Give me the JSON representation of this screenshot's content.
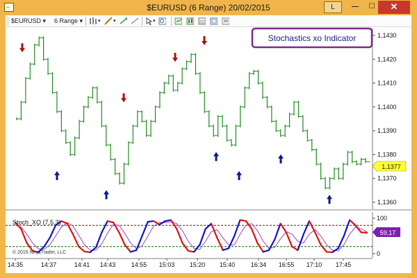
{
  "window": {
    "title": "$EURUSD (6 Range)  20/02/2015",
    "minimize_icon": "minimize-icon",
    "maximize_icon": "maximize-icon",
    "close_icon": "close-icon",
    "restore_label": "L",
    "close_label": "✕",
    "minimize_label": "—",
    "maximize_label": "☐"
  },
  "toolbar": {
    "instrument": "$EURUSD",
    "period": "6 Range",
    "icons": [
      "bar-type-icon",
      "pencil-icon",
      "drawing-tools-icon",
      "pointer-icon",
      "zoom-icon",
      "data-box-icon",
      "properties-icon",
      "indicators-icon",
      "strategies-icon"
    ]
  },
  "annotation": {
    "label": "Stochastics xo Indicator",
    "border_color": "#7b2a86"
  },
  "price_axis": {
    "ticks": [
      "1,1430",
      "1,1420",
      "1,1410",
      "1,1400",
      "1,1390",
      "1,1380",
      "1,1370",
      "1,1360"
    ],
    "current_price": "1,1377",
    "current_price_color": "#ffff00"
  },
  "indicator_panel": {
    "title": "Stoch_XO (7,5,3)",
    "copyright": "© 2015 NinjaTrader, LLC",
    "ticks": [
      "100",
      "0"
    ],
    "current_value": "59,17",
    "current_value_color": "#7f1fb0",
    "overbought_line_color": "#8b0000",
    "oversold_line_color": "#006400"
  },
  "time_axis": {
    "labels": [
      "14:35",
      "14:37",
      "14:41",
      "14:43",
      "14:55",
      "15:03",
      "15:20",
      "15:40",
      "16:34",
      "16:55",
      "17:10",
      "17:45"
    ]
  },
  "colors": {
    "frame": "#f0b54a",
    "price_bars": "#1f8a1f",
    "up_arrow": "#0a1a8a",
    "down_arrow": "#b01010",
    "stoch_k_up": "#1010d0",
    "stoch_k_down": "#e01010",
    "stoch_d": "#a040c0"
  },
  "chart_data": {
    "type": "line",
    "instrument": "$EURUSD",
    "period": "6 Range",
    "date": "20/02/2015",
    "ylim": [
      1.1358,
      1.1435
    ],
    "price_series": [
      1.1395,
      1.1402,
      1.1412,
      1.1418,
      1.1426,
      1.1429,
      1.142,
      1.1414,
      1.1406,
      1.1398,
      1.139,
      1.1385,
      1.138,
      1.1387,
      1.1394,
      1.14,
      1.1404,
      1.1408,
      1.1402,
      1.1392,
      1.1384,
      1.1378,
      1.1372,
      1.1368,
      1.1376,
      1.1385,
      1.1392,
      1.1398,
      1.1394,
      1.1388,
      1.1394,
      1.14,
      1.1406,
      1.141,
      1.1413,
      1.1407,
      1.141,
      1.1416,
      1.1419,
      1.1422,
      1.1414,
      1.1406,
      1.1398,
      1.1392,
      1.1388,
      1.1396,
      1.1392,
      1.1386,
      1.1384,
      1.1392,
      1.14,
      1.1408,
      1.1414,
      1.1415,
      1.141,
      1.1404,
      1.14,
      1.1394,
      1.139,
      1.1388,
      1.1392,
      1.1397,
      1.1402,
      1.1396,
      1.139,
      1.1386,
      1.1382,
      1.1376,
      1.137,
      1.1366,
      1.137,
      1.1374,
      1.137,
      1.1376,
      1.1381,
      1.1377,
      1.1376,
      1.1378,
      1.1377
    ],
    "buy_signals": [
      {
        "time": "14:37",
        "price": 1.1376
      },
      {
        "time": "14:43",
        "price": 1.1368
      },
      {
        "time": "15:20",
        "price": 1.1384
      },
      {
        "time": "15:40",
        "price": 1.1376
      },
      {
        "time": "16:55",
        "price": 1.1383
      },
      {
        "time": "17:45",
        "price": 1.1366
      }
    ],
    "sell_signals": [
      {
        "time": "14:35",
        "price": 1.142
      },
      {
        "time": "14:43",
        "price": 1.1399
      },
      {
        "time": "15:03",
        "price": 1.1416
      },
      {
        "time": "15:20",
        "price": 1.1423
      },
      {
        "time": "16:34",
        "price": 1.1425
      }
    ],
    "stoch_k": [
      88,
      70,
      30,
      8,
      4,
      20,
      45,
      80,
      92,
      85,
      55,
      20,
      6,
      4,
      18,
      60,
      92,
      88,
      60,
      25,
      5,
      10,
      50,
      90,
      92,
      82,
      92,
      95,
      70,
      30,
      8,
      5,
      25,
      70,
      85,
      45,
      10,
      15,
      50,
      95,
      92,
      70,
      30,
      5,
      10,
      40,
      85,
      60,
      20,
      10,
      55,
      92,
      60,
      25,
      5,
      4,
      15,
      50,
      95,
      80,
      60,
      59
    ],
    "stoch_d": [
      80,
      75,
      55,
      30,
      14,
      12,
      25,
      50,
      75,
      88,
      78,
      52,
      25,
      10,
      10,
      28,
      58,
      82,
      80,
      57,
      30,
      14,
      22,
      50,
      78,
      88,
      88,
      90,
      85,
      65,
      35,
      15,
      12,
      35,
      62,
      68,
      45,
      25,
      25,
      55,
      80,
      85,
      65,
      35,
      15,
      18,
      42,
      62,
      55,
      35,
      30,
      55,
      68,
      50,
      25,
      10,
      8,
      25,
      55,
      75,
      70,
      62
    ],
    "stoch_levels": [
      80,
      20
    ]
  }
}
